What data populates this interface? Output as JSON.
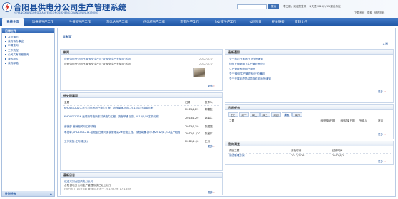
{
  "header": {
    "title": "合阳县供电分公司生产管理系统",
    "subtitle": "HEYANGXIANGONGDIANFENGONGSISHENGCHANGUANLIXITONG",
    "search_placeholder": "",
    "search_button": "搜索",
    "user_info": "李文建，欢迎您登录！今天是2013/1/31   退出系统",
    "links": [
      "下载系统",
      "帮助",
      "修改密码"
    ]
  },
  "nav": {
    "items": [
      "系统主页",
      "运维班生产工作",
      "生技部生产工作",
      "营电站生产工作",
      "供电所生产工作",
      "营销生产工作",
      "办公室生产工作",
      "公司项目",
      "相关链接",
      "资料文档"
    ],
    "active_index": 0
  },
  "sidebar": {
    "title": "日常工作",
    "items": [
      "发起请示",
      "我的待办事宜",
      "申请查询",
      "工作流程",
      "公司共有流程查询",
      "我的新人",
      "我的邮箱"
    ],
    "bottom": "计划任务"
  },
  "main": {
    "custom": {
      "title": "定制页",
      "link": "定制"
    },
    "news": {
      "title": "新闻",
      "items": [
        {
          "text": "合阳供电分公司开展'安全生产月'暨'安全生产大整改'活动",
          "date": "2012/7/27"
        },
        {
          "text": "合阳供电分公司开展'安全生产月'暨'安全生产大整改'活动",
          "date": "2012/7/27"
        }
      ],
      "more": "更多"
    },
    "todo": {
      "title": "待处理事项",
      "headers": [
        "主题",
        "日期",
        "发件人"
      ],
      "rows": [
        {
          "subject": "KHDLGCL227-北关村电所新户电力工程，流程单通-回执-2013/1/29富锦线程",
          "date": "2013/1/29",
          "sender": "郭建生"
        },
        {
          "subject": "KHDLGCL226-运城新坊电所农村峡电力工程，流程单通-回执-2013/1/29富锦线程",
          "date": "2013/1/29",
          "sender": "郭建生"
        },
        {
          "subject": "营销部-营销相关月工作流程",
          "date": "2013/1/10",
          "sender": "张国强"
        },
        {
          "subject": "审批单,KHDLGCL211-合阳县白家河乡镇管理站2#配电工程，流程单通-协小-审2012/11/12生产经理",
          "date": "2012/11/20",
          "sender": "张宝平"
        },
        {
          "subject": "工作实施-王月涌(无)",
          "date": "2012/11/6",
          "sender": "王月"
        }
      ],
      "more": "更多"
    },
    "logs": {
      "title": "最新日志",
      "lines": [
        "欢迎来到合阳供电分公司",
        "合阳供电分公司生产管理系统已经上线了",
        "(0)日志 | (1)(2)(4) 管理员 发表于 2012/7/26 17:16:59"
      ],
      "more": "更多"
    },
    "notice": {
      "title": "最新通知",
      "items": [
        "关于表彰日常运行工作的通知",
        "如何正确使用《生产管理系统》",
        "生产管理系统用户手册",
        "关于'使用生产管理系统'的通知",
        "关于开展年终总结同年终初检的通知"
      ],
      "more": "更多"
    },
    "schedule": {
      "title": "日程任务",
      "tabs": [
        "日日",
        "周一",
        "周二",
        "周三",
        "周四",
        "周五",
        "周六"
      ],
      "active_tab": 5,
      "headers": [
        "主题",
        "计划开始日期",
        "计划结束日期",
        "完成人",
        "状态"
      ],
      "more": "更多"
    },
    "survey": {
      "title": "我的调查",
      "headers": [
        "调查主题",
        "开始时间",
        "结束时间"
      ],
      "rows": [
        {
          "subject": "测试管理方案",
          "start": "2012/7/26",
          "end": "2012/8/2"
        }
      ],
      "more": "更多"
    }
  },
  "colors": {
    "brand": "#1b4f9c",
    "nav": "#2c62b0",
    "accent_more": "#cc3333"
  }
}
